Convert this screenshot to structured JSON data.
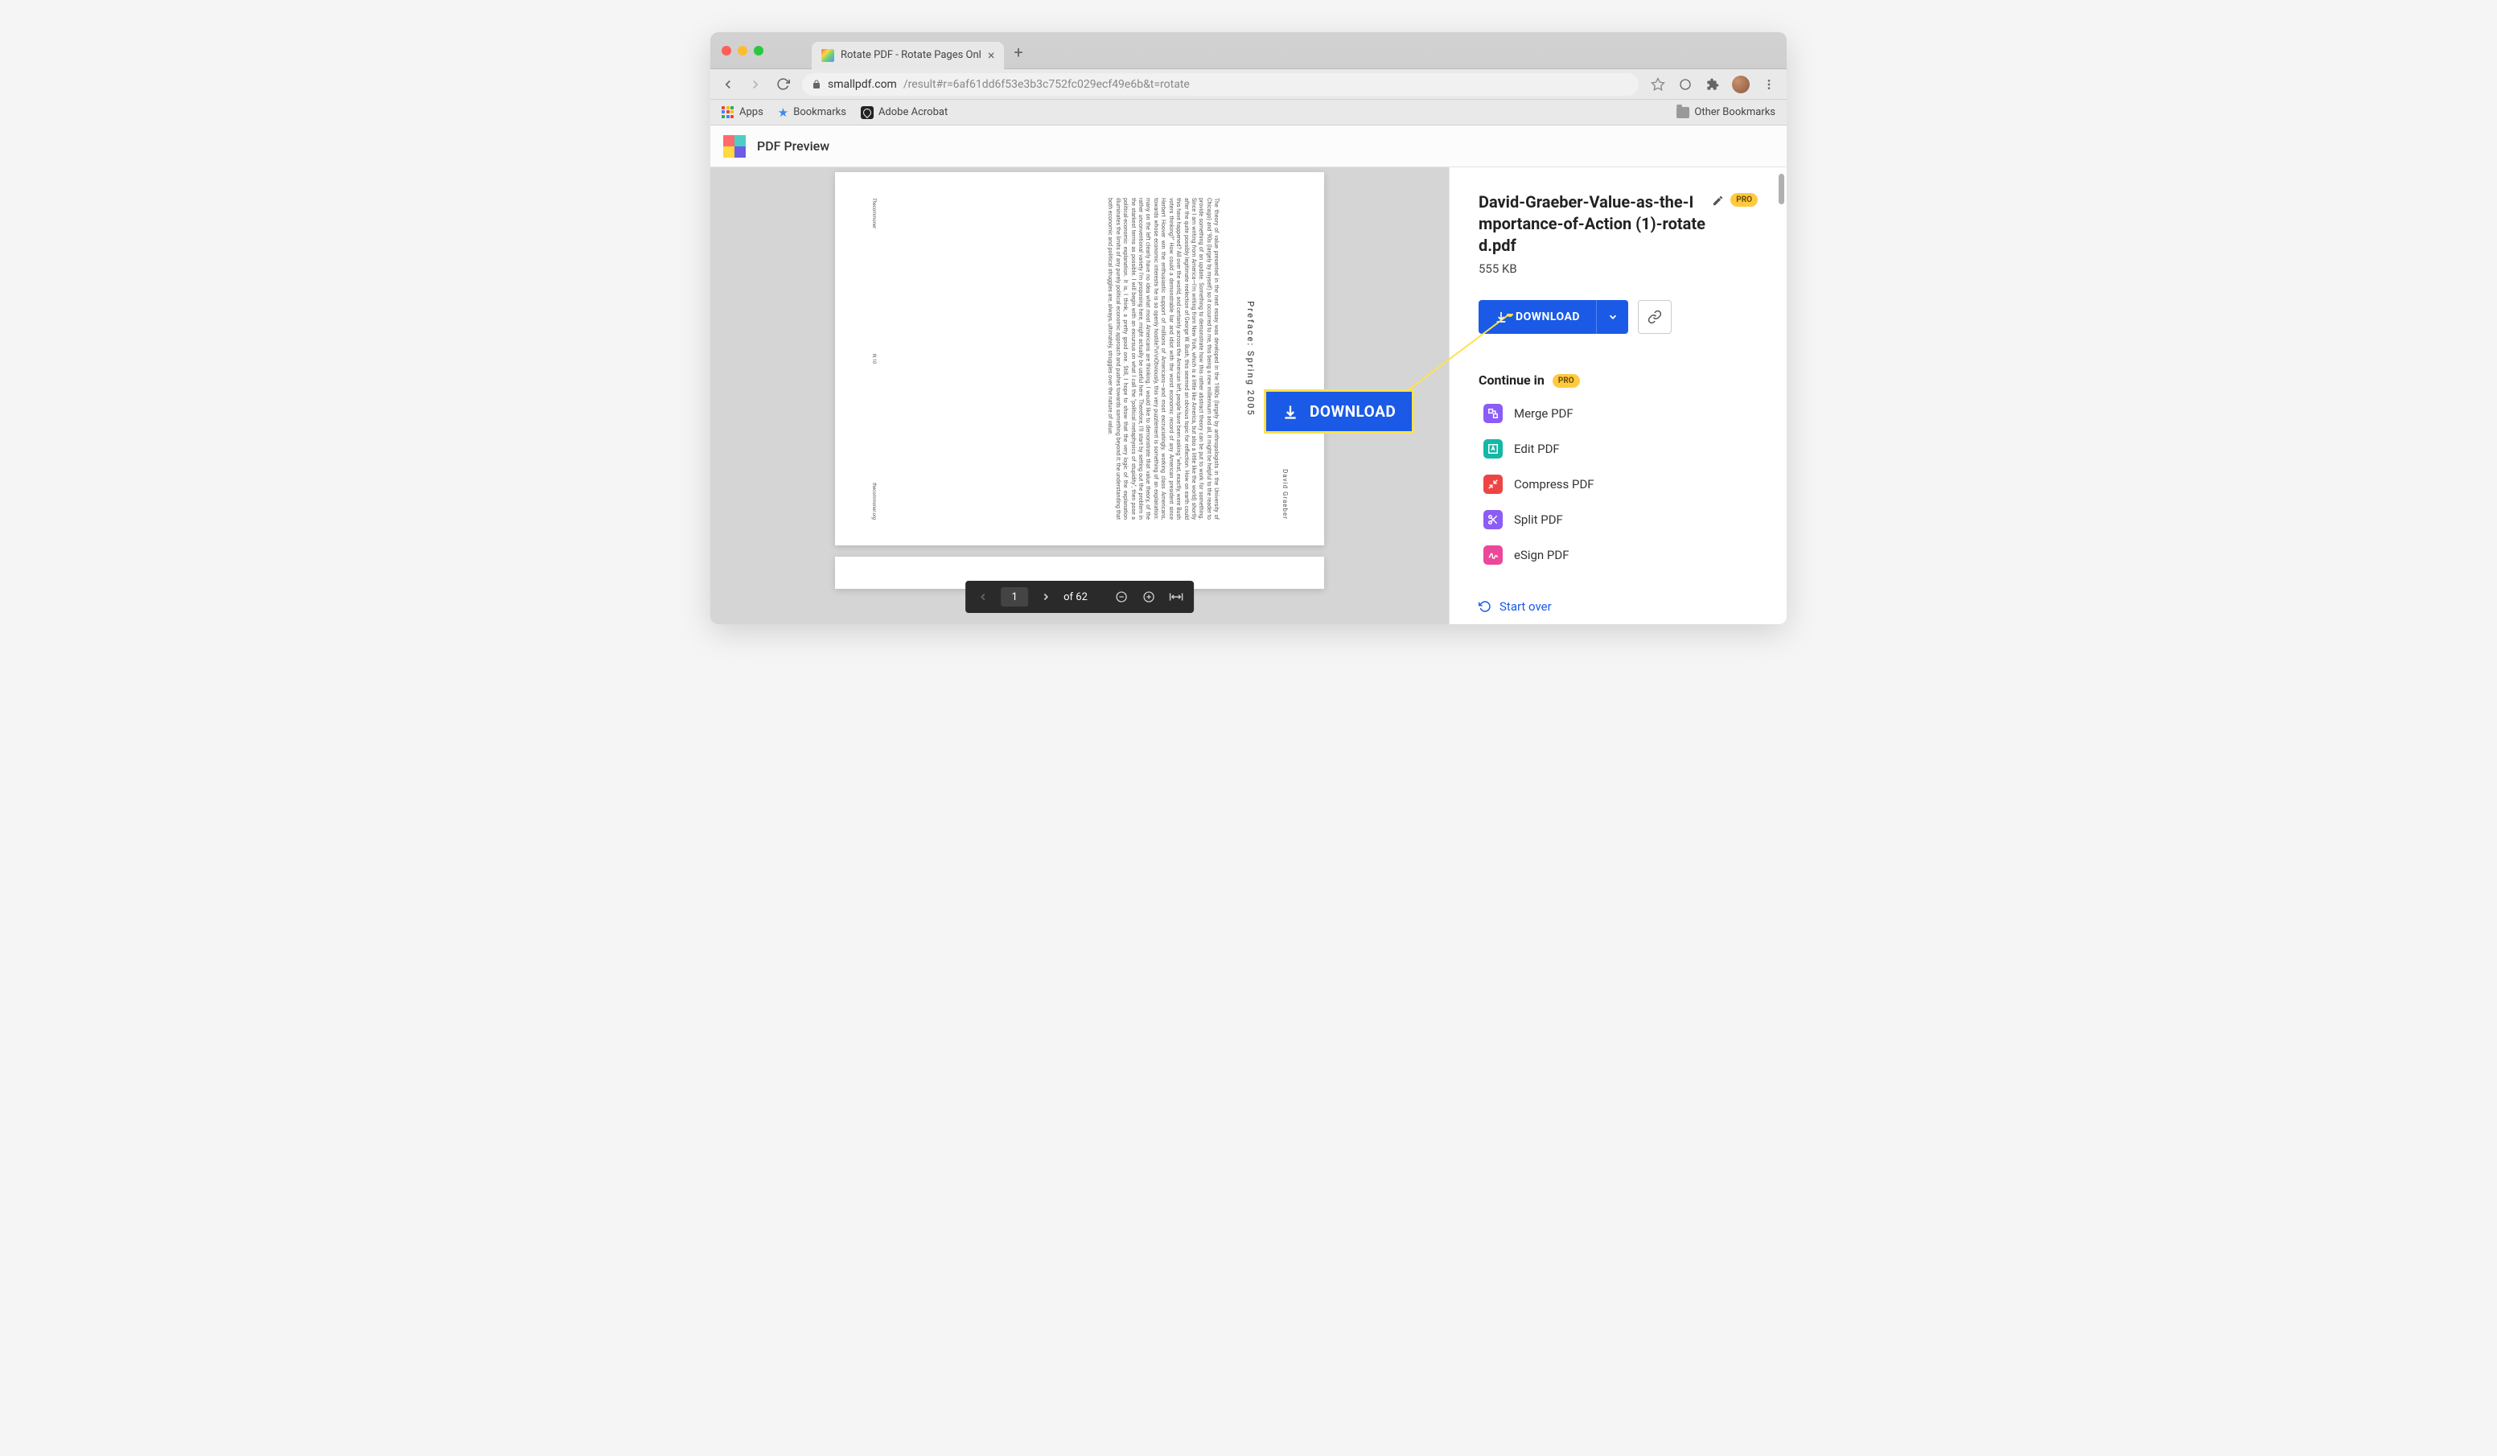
{
  "browser": {
    "tab_title": "Rotate PDF - Rotate Pages Onl",
    "url_host": "smallpdf.com",
    "url_path": "/result#r=6af61dd6f53e3b3c752fc029ecf49e6b&t=rotate",
    "bookmarks": {
      "apps": "Apps",
      "bookmarks": "Bookmarks",
      "acrobat": "Adobe Acrobat",
      "other": "Other Bookmarks"
    }
  },
  "app": {
    "title": "PDF Preview"
  },
  "document": {
    "heading": "Preface: Spring 2005",
    "author": "David Graeber",
    "body": "The theory of value presented in the next essay was developed in the 1980s (largely by anthropologists in the University of Chicago) and '90s (largely by myself) so it occurred to me, this being a new millennium and all, it might be helpful to the reader to provide something of an update. Something to demonstrate how this rather abstract theory can be put to work for something. Since I am writing from America—I'm writing from New York, which is a little like America, but also a little like the world) shortly after the quite possibly legitimate reelection of George W. Bush, this seemed an obvious topic for reflection. How on earth could this have happened? All over the world, and certainly across the American left, people have been asking \"what, exactly, were Bush voters thinking?\" How could a demonstrable liar and idiot with the worst economic record of any American president since Herbert Hoover win the enthusiastic support of millions of Americans—and most excruciatingly, working class Americans, towards whose economic interests he is so openly hostile?\\n\\nObviously, this very puzzlement is something of an explanation: many on the left clearly have no idea what most Americans are thinking. I would like to demonstrate that value theory, of the rather unconventional variety I'm proposing here, might actually be useful here. Therefore, I'll start by setting out the problem in the starkest terms as possible. I will begin with an excursus on what I call the \"political metaphysics of stupidity\", then pose a political-economic explanation. It is, I think, a pretty good one. Still, I hope to show that the very logic of the explanation illuminates the limits of any purely political economic approach and pushes towards something beyond it: the understanding that both economic and political struggles are, always, ultimately, struggles over the nature of value.",
    "footer_left": "Thecommoner",
    "footer_center": "N.10",
    "footer_right": "thecommoner.org"
  },
  "controls": {
    "current_page": "1",
    "total_pages": "of 62"
  },
  "sidebar": {
    "filename": "David-Graeber-Value-as-the-Importance-of-Action (1)-rotated.pdf",
    "pro": "PRO",
    "filesize": "555 KB",
    "download": "DOWNLOAD",
    "continue_in": "Continue in",
    "tools": [
      {
        "label": "Merge PDF",
        "color": "#8b5cf6"
      },
      {
        "label": "Edit PDF",
        "color": "#14b8a6"
      },
      {
        "label": "Compress PDF",
        "color": "#ef4444"
      },
      {
        "label": "Split PDF",
        "color": "#8b5cf6"
      },
      {
        "label": "eSign PDF",
        "color": "#ec4899"
      }
    ],
    "start_over": "Start over"
  },
  "callout": {
    "label": "DOWNLOAD"
  }
}
